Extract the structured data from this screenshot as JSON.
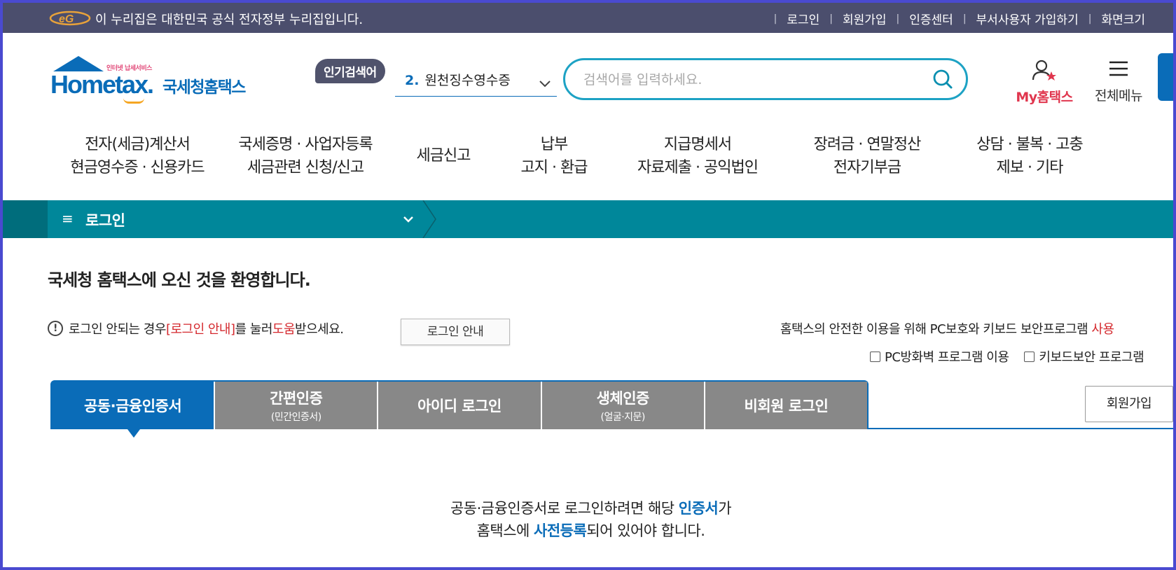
{
  "govbar": {
    "text": "이 누리집은 대한민국 공식 전자정부 누리집입니다.",
    "links": [
      "로그인",
      "회원가입",
      "인증센터",
      "부서사용자 가입하기",
      "화면크기"
    ]
  },
  "header": {
    "logo_small": "인터넷 납세서비스",
    "logo_main": "Hometax.",
    "logo_kr": "국세청홈택스",
    "popular_label": "인기검색어",
    "rank_num": "2.",
    "rank_keyword": "원천징수영수증",
    "search_placeholder": "검색어를 입력하세요.",
    "my_label": "My홈택스",
    "menu_label": "전체메뉴"
  },
  "nav": [
    {
      "line1": "전자(세금)계산서",
      "line2": "현금영수증 · 신용카드"
    },
    {
      "line1": "국세증명 · 사업자등록",
      "line2": "세금관련 신청/신고"
    },
    {
      "line1": "세금신고",
      "line2": ""
    },
    {
      "line1": "납부",
      "line2": "고지 · 환급"
    },
    {
      "line1": "지급명세서",
      "line2": "자료제출 · 공익법인"
    },
    {
      "line1": "장려금 · 연말정산",
      "line2": "전자기부금"
    },
    {
      "line1": "상담 · 불복 · 고충",
      "line2": "제보 · 기타"
    }
  ],
  "breadcrumb": {
    "title": "로그인"
  },
  "welcome": "국세청 홈택스에 오신 것을 환영합니다.",
  "notice": {
    "part1": "로그인 안되는 경우 ",
    "part2": "[로그인 안내]",
    "part3": "를 눌러 ",
    "part4": "도움",
    "part5": "받으세요.",
    "button": "로그인 안내"
  },
  "security": {
    "text": "홈택스의 안전한 이용을 위해 PC보호와 키보드 보안프로그램 ",
    "red": "사용",
    "check1": "PC방화벽 프로그램 이용",
    "check2": "키보드보안 프로그램"
  },
  "tabs": [
    {
      "label": "공동·금융인증서",
      "sub": ""
    },
    {
      "label": "간편인증",
      "sub": "(민간인증서)"
    },
    {
      "label": "아이디 로그인",
      "sub": ""
    },
    {
      "label": "생체인증",
      "sub": "(얼굴·지문)"
    },
    {
      "label": "비회원 로그인",
      "sub": ""
    }
  ],
  "join_button": "회원가입",
  "cert_message": {
    "l1a": "공동·금융인증서로 로그인하려면 해당 ",
    "l1b": "인증서",
    "l1c": "가",
    "l2a": "홈택스에 ",
    "l2b": "사전등록",
    "l2c": "되어 있어야 합니다."
  },
  "colors": {
    "accent": "#0a6cb8",
    "teal": "#00879a",
    "gov": "#4b4e6d",
    "red": "#d4282d"
  }
}
